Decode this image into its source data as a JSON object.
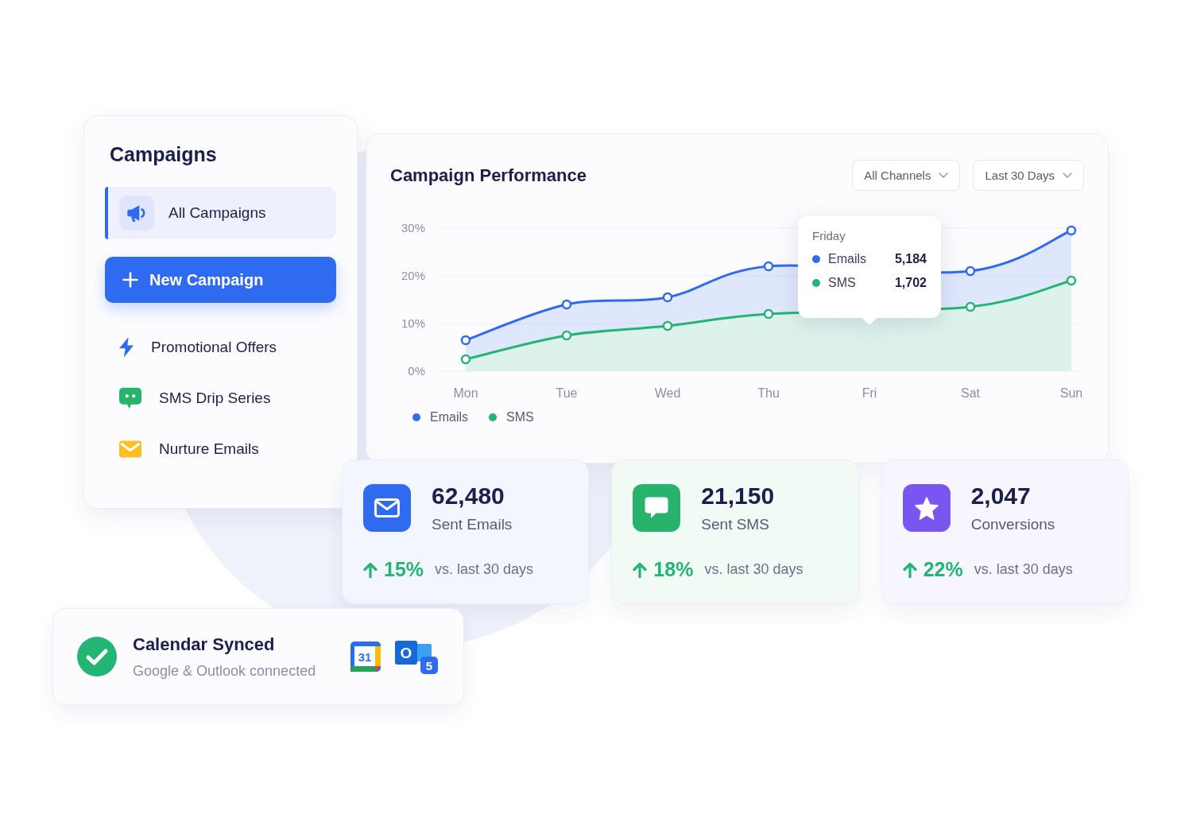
{
  "campaigns_panel": {
    "title": "Campaigns",
    "filter": {
      "label": "All Campaigns",
      "selected": true
    },
    "new_button": {
      "label": "New Campaign"
    },
    "items": [
      {
        "kind": "offer",
        "label": "Promotional Offers",
        "color": "#2f6bf0",
        "selected": false
      },
      {
        "kind": "sms",
        "label": "SMS Drip Series",
        "color": "#27b36b",
        "selected": false
      },
      {
        "kind": "email",
        "label": "Nurture Emails",
        "color": "#fbbf24",
        "selected": false
      }
    ]
  },
  "performance": {
    "title": "Campaign Performance",
    "filters": [
      {
        "label": "All Channels"
      },
      {
        "label": "Last 30 Days"
      }
    ],
    "chart_data": {
      "type": "area",
      "categories": [
        "Mon",
        "Tue",
        "Wed",
        "Thu",
        "Fri",
        "Sat",
        "Sun"
      ],
      "ylim": [
        0,
        30
      ],
      "yticks": [
        {
          "value": 0,
          "label": "0%"
        },
        {
          "value": 10,
          "label": "10%"
        },
        {
          "value": 20,
          "label": "20%"
        },
        {
          "value": 30,
          "label": "30%"
        }
      ],
      "series": [
        {
          "name": "Emails",
          "color": "#2f6bf0",
          "marker": true,
          "values": [
            6.5,
            14,
            15.5,
            22,
            null,
            21,
            29.5
          ]
        },
        {
          "name": "SMS",
          "color": "#22b573",
          "marker": true,
          "values": [
            2.5,
            7.5,
            9.5,
            12,
            null,
            13.5,
            19
          ]
        }
      ]
    },
    "tooltip": {
      "title": "Friday",
      "rows": [
        {
          "label": "Emails",
          "value": "5,184",
          "color": "#2f6bf0"
        },
        {
          "label": "SMS",
          "value": "1,702",
          "color": "#22b573"
        }
      ]
    }
  },
  "stats": [
    {
      "kind": "email",
      "value": "62,480",
      "label": "Sent Emails",
      "change": "15%",
      "comparison": "vs. last 30 days",
      "color": "#2f6bf0"
    },
    {
      "kind": "sms",
      "value": "21,150",
      "label": "Sent SMS",
      "change": "18%",
      "comparison": "vs. last 30 days",
      "color": "#27b36b"
    },
    {
      "kind": "conversion",
      "value": "2,047",
      "label": "Conversions",
      "change": "22%",
      "comparison": "vs. last 30 days",
      "color": "#7856ef"
    }
  ],
  "calendar_card": {
    "title": "Calendar Synced",
    "subtitle": "Google & Outlook connected",
    "apps": [
      {
        "kind": "calendar",
        "text": "31"
      },
      {
        "kind": "mail",
        "text": "O",
        "badge": "5"
      }
    ]
  }
}
